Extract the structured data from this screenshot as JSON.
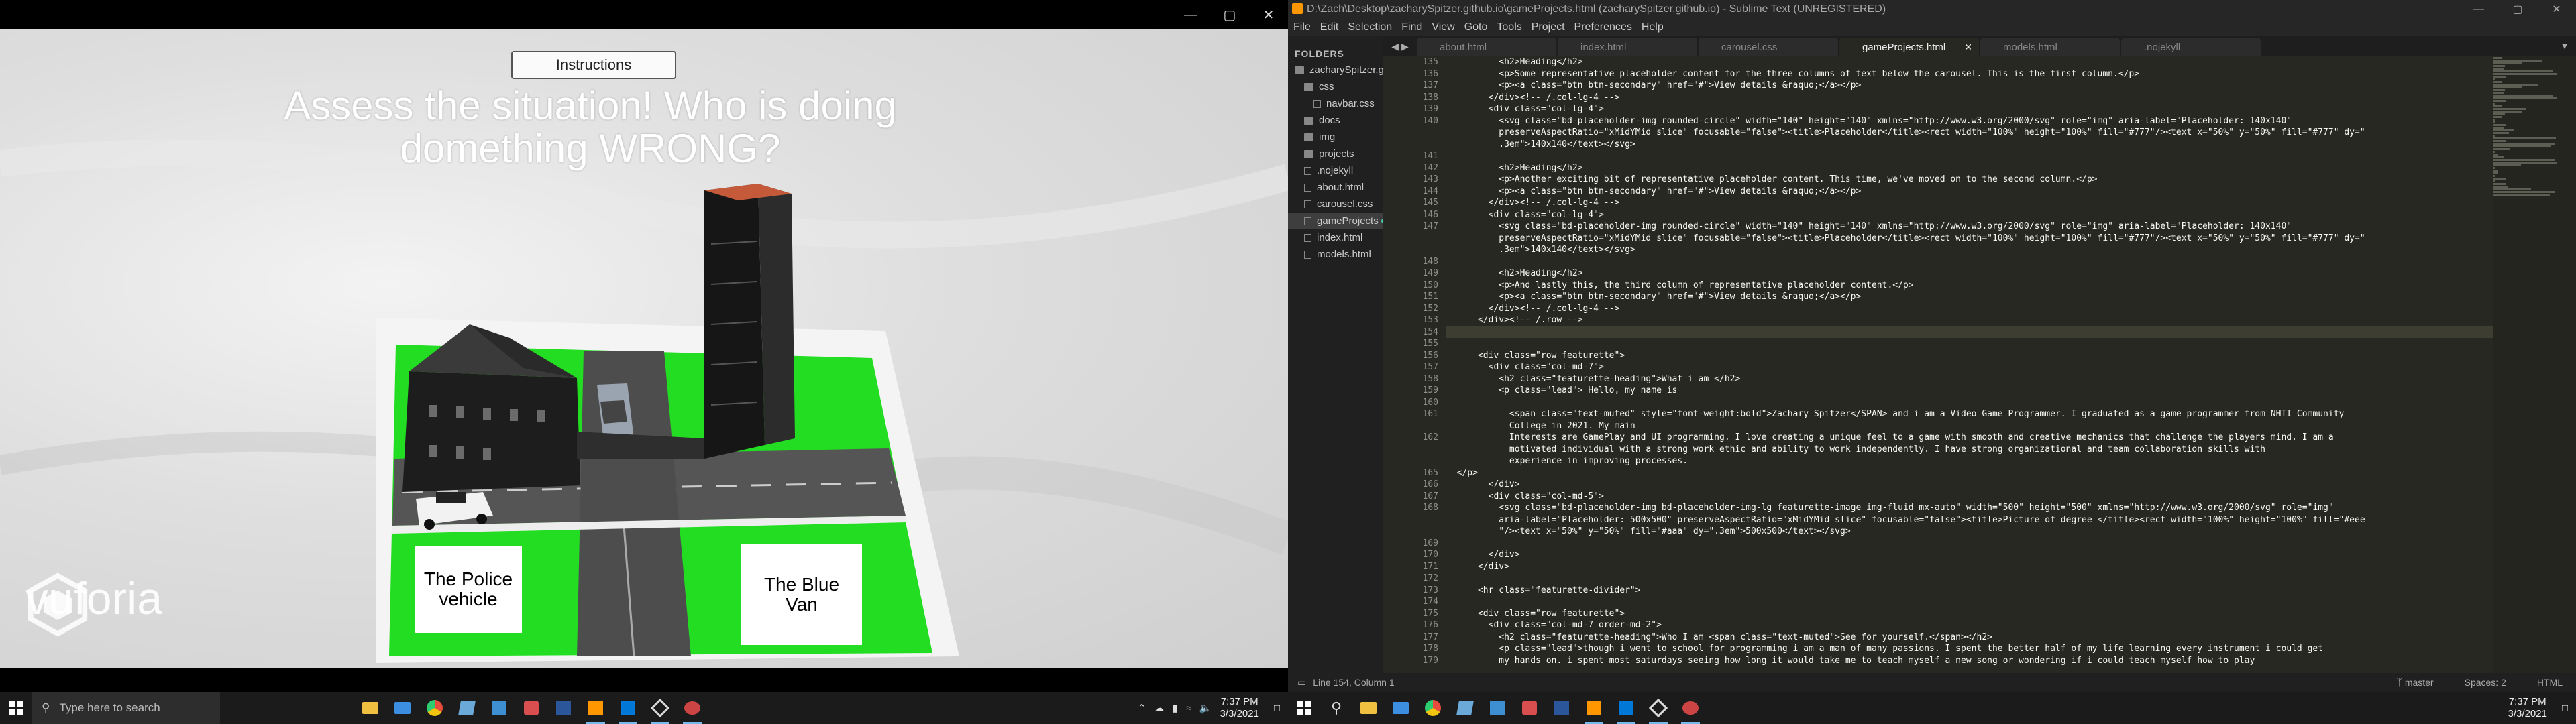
{
  "game": {
    "instructions_label": "Instructions",
    "title_line1": "Assess the situation! Who is doing",
    "title_line2": "domething WRONG?",
    "sign_left": "The Police vehicle",
    "sign_right": "The Blue Van",
    "watermark": "vuforia",
    "window_controls": [
      "—",
      "▢",
      "✕"
    ]
  },
  "taskbar_left": {
    "search_placeholder": "Type here to search",
    "time": "7:37 PM",
    "date": "3/3/2021",
    "apps": [
      "file-explorer-icon",
      "mail-icon",
      "chrome-icon",
      "app-icon",
      "sublime-icon",
      "app-icon",
      "word-icon",
      "sublime-icon",
      "vs-icon",
      "unity-icon",
      "app-icon"
    ]
  },
  "taskbar_right": {
    "time": "7:37 PM",
    "date": "3/3/2021"
  },
  "sublime": {
    "title": "D:\\Zach\\Desktop\\zacharySpitzer.github.io\\gameProjects.html (zacharySpitzer.github.io) - Sublime Text (UNREGISTERED)",
    "menu": [
      "File",
      "Edit",
      "Selection",
      "Find",
      "View",
      "Goto",
      "Tools",
      "Project",
      "Preferences",
      "Help"
    ],
    "sidebar_header": "FOLDERS",
    "tree": [
      {
        "label": "zacharySpitzer.g",
        "type": "folder",
        "indent": 0,
        "dot": true
      },
      {
        "label": "css",
        "type": "folder",
        "indent": 1
      },
      {
        "label": "navbar.css",
        "type": "file",
        "indent": 2
      },
      {
        "label": "docs",
        "type": "folder",
        "indent": 1
      },
      {
        "label": "img",
        "type": "folder",
        "indent": 1
      },
      {
        "label": "projects",
        "type": "folder",
        "indent": 1
      },
      {
        "label": ".nojekyll",
        "type": "file",
        "indent": 1
      },
      {
        "label": "about.html",
        "type": "file",
        "indent": 1
      },
      {
        "label": "carousel.css",
        "type": "file",
        "indent": 1
      },
      {
        "label": "gameProjects",
        "type": "file",
        "indent": 1,
        "selected": true,
        "dot": true
      },
      {
        "label": "index.html",
        "type": "file",
        "indent": 1
      },
      {
        "label": "models.html",
        "type": "file",
        "indent": 1
      }
    ],
    "tabs": [
      {
        "label": "about.html",
        "active": false
      },
      {
        "label": "index.html",
        "active": false
      },
      {
        "label": "carousel.css",
        "active": false
      },
      {
        "label": "gameProjects.html",
        "active": true
      },
      {
        "label": "models.html",
        "active": false
      },
      {
        "label": ".nojekyll",
        "active": false
      }
    ],
    "lines": [
      {
        "n": "135",
        "t": "          <h2>Heading</h2>"
      },
      {
        "n": "136",
        "t": "          <p>Some representative placeholder content for the three columns of text below the carousel. This is the first column.</p>"
      },
      {
        "n": "137",
        "t": "          <p><a class=\"btn btn-secondary\" href=\"#\">View details &raquo;</a></p>"
      },
      {
        "n": "138",
        "t": "        </div><!-- /.col-lg-4 -->"
      },
      {
        "n": "139",
        "t": "        <div class=\"col-lg-4\">"
      },
      {
        "n": "140",
        "t": "          <svg class=\"bd-placeholder-img rounded-circle\" width=\"140\" height=\"140\" xmlns=\"http://www.w3.org/2000/svg\" role=\"img\" aria-label=\"Placeholder: 140x140\""
      },
      {
        "n": "",
        "t": "          preserveAspectRatio=\"xMidYMid slice\" focusable=\"false\"><title>Placeholder</title><rect width=\"100%\" height=\"100%\" fill=\"#777\"/><text x=\"50%\" y=\"50%\" fill=\"#777\" dy=\""
      },
      {
        "n": "",
        "t": "          .3em\">140x140</text></svg>"
      },
      {
        "n": "141",
        "t": ""
      },
      {
        "n": "142",
        "t": "          <h2>Heading</h2>"
      },
      {
        "n": "143",
        "t": "          <p>Another exciting bit of representative placeholder content. This time, we've moved on to the second column.</p>"
      },
      {
        "n": "144",
        "t": "          <p><a class=\"btn btn-secondary\" href=\"#\">View details &raquo;</a></p>"
      },
      {
        "n": "145",
        "t": "        </div><!-- /.col-lg-4 -->"
      },
      {
        "n": "146",
        "t": "        <div class=\"col-lg-4\">"
      },
      {
        "n": "147",
        "t": "          <svg class=\"bd-placeholder-img rounded-circle\" width=\"140\" height=\"140\" xmlns=\"http://www.w3.org/2000/svg\" role=\"img\" aria-label=\"Placeholder: 140x140\""
      },
      {
        "n": "",
        "t": "          preserveAspectRatio=\"xMidYMid slice\" focusable=\"false\"><title>Placeholder</title><rect width=\"100%\" height=\"100%\" fill=\"#777\"/><text x=\"50%\" y=\"50%\" fill=\"#777\" dy=\""
      },
      {
        "n": "",
        "t": "          .3em\">140x140</text></svg>"
      },
      {
        "n": "148",
        "t": ""
      },
      {
        "n": "149",
        "t": "          <h2>Heading</h2>"
      },
      {
        "n": "150",
        "t": "          <p>And lastly this, the third column of representative placeholder content.</p>"
      },
      {
        "n": "151",
        "t": "          <p><a class=\"btn btn-secondary\" href=\"#\">View details &raquo;</a></p>"
      },
      {
        "n": "152",
        "t": "        </div><!-- /.col-lg-4 -->"
      },
      {
        "n": "153",
        "t": "      </div><!-- /.row -->"
      },
      {
        "n": "154",
        "t": ""
      },
      {
        "n": "155",
        "t": ""
      },
      {
        "n": "156",
        "t": "      <div class=\"row featurette\">"
      },
      {
        "n": "157",
        "t": "        <div class=\"col-md-7\">"
      },
      {
        "n": "158",
        "t": "          <h2 class=\"featurette-heading\">What i am </h2>"
      },
      {
        "n": "159",
        "t": "          <p class=\"lead\"> Hello, my name is"
      },
      {
        "n": "160",
        "t": ""
      },
      {
        "n": "161",
        "t": "            <span class=\"text-muted\" style=\"font-weight:bold\">Zachary Spitzer</SPAN> and i am a Video Game Programmer. I graduated as a game programmer from NHTI Community"
      },
      {
        "n": "",
        "t": "            College in 2021. My main"
      },
      {
        "n": "162",
        "t": "            Interests are GamePlay and UI programming. I love creating a unique feel to a game with smooth and creative mechanics that challenge the players mind. I am a"
      },
      {
        "n": "",
        "t": "            motivated individual with a strong work ethic and ability to work independently. I have strong organizational and team collaboration skills with"
      },
      {
        "n": "",
        "t": "            experience in improving processes."
      },
      {
        "n": "165",
        "t": "  </p>"
      },
      {
        "n": "166",
        "t": "        </div>"
      },
      {
        "n": "167",
        "t": "        <div class=\"col-md-5\">"
      },
      {
        "n": "168",
        "t": "          <svg class=\"bd-placeholder-img bd-placeholder-img-lg featurette-image img-fluid mx-auto\" width=\"500\" height=\"500\" xmlns=\"http://www.w3.org/2000/svg\" role=\"img\""
      },
      {
        "n": "",
        "t": "          aria-label=\"Placeholder: 500x500\" preserveAspectRatio=\"xMidYMid slice\" focusable=\"false\"><title>Picture of degree </title><rect width=\"100%\" height=\"100%\" fill=\"#eee"
      },
      {
        "n": "",
        "t": "          \"/><text x=\"50%\" y=\"50%\" fill=\"#aaa\" dy=\".3em\">500x500</text></svg>"
      },
      {
        "n": "169",
        "t": ""
      },
      {
        "n": "170",
        "t": "        </div>"
      },
      {
        "n": "171",
        "t": "      </div>"
      },
      {
        "n": "172",
        "t": ""
      },
      {
        "n": "173",
        "t": "      <hr class=\"featurette-divider\">"
      },
      {
        "n": "174",
        "t": ""
      },
      {
        "n": "175",
        "t": "      <div class=\"row featurette\">"
      },
      {
        "n": "176",
        "t": "        <div class=\"col-md-7 order-md-2\">"
      },
      {
        "n": "177",
        "t": "          <h2 class=\"featurette-heading\">Who I am <span class=\"text-muted\">See for yourself.</span></h2>"
      },
      {
        "n": "178",
        "t": "          <p class=\"lead\">though i went to school for programming i am a man of many passions. I spent the better half of my life learning every instrument i could get"
      },
      {
        "n": "179",
        "t": "          my hands on. i spent most saturdays seeing how long it would take me to teach myself a new song or wondering if i could teach myself how to play"
      }
    ],
    "status_left": "Line 154, Column 1",
    "status_branch": "master",
    "status_spaces": "Spaces: 2",
    "status_syntax": "HTML",
    "window_controls": [
      "—",
      "▢",
      "✕"
    ]
  }
}
